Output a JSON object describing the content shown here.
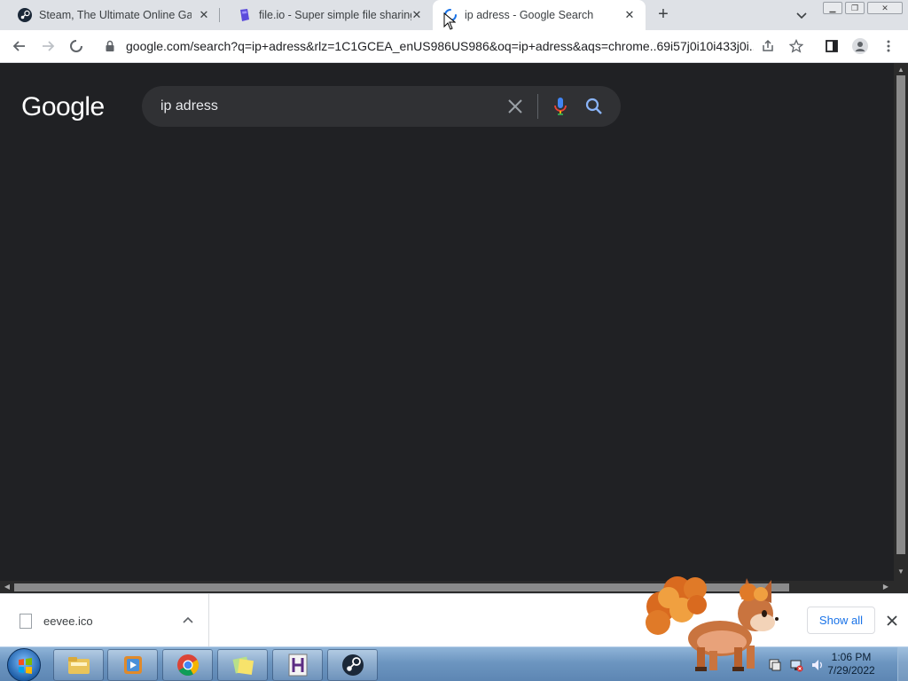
{
  "browser": {
    "tabs": [
      {
        "title": "Steam, The Ultimate Online Game Platform",
        "icon": "steam-icon",
        "active": false
      },
      {
        "title": "file.io - Super simple file sharing",
        "icon": "fileio-icon",
        "active": false
      },
      {
        "title": "ip adress - Google Search",
        "icon": "loading-spinner-icon",
        "active": true
      }
    ],
    "new_tab_label": "+",
    "address_url": "google.com/search?q=ip+adress&rlz=1C1GCEA_enUS986US986&oq=ip+adress&aqs=chrome..69i57j0i10i433j0i..."
  },
  "google": {
    "logo_text": "Google",
    "search_query": "ip adress"
  },
  "downloads": {
    "items": [
      {
        "filename": "eevee.ico"
      }
    ],
    "show_all_label": "Show all"
  },
  "taskbar": {
    "time": "1:06 PM",
    "date": "7/29/2022",
    "pinned": [
      "file-explorer",
      "media-player",
      "chrome",
      "sticky-notes",
      "hammer-editor",
      "steam"
    ]
  },
  "colors": {
    "page_bg": "#202124",
    "searchbox_bg": "#303134",
    "accent_blue": "#1a73e8",
    "tabstrip_bg": "#dee1e6"
  }
}
